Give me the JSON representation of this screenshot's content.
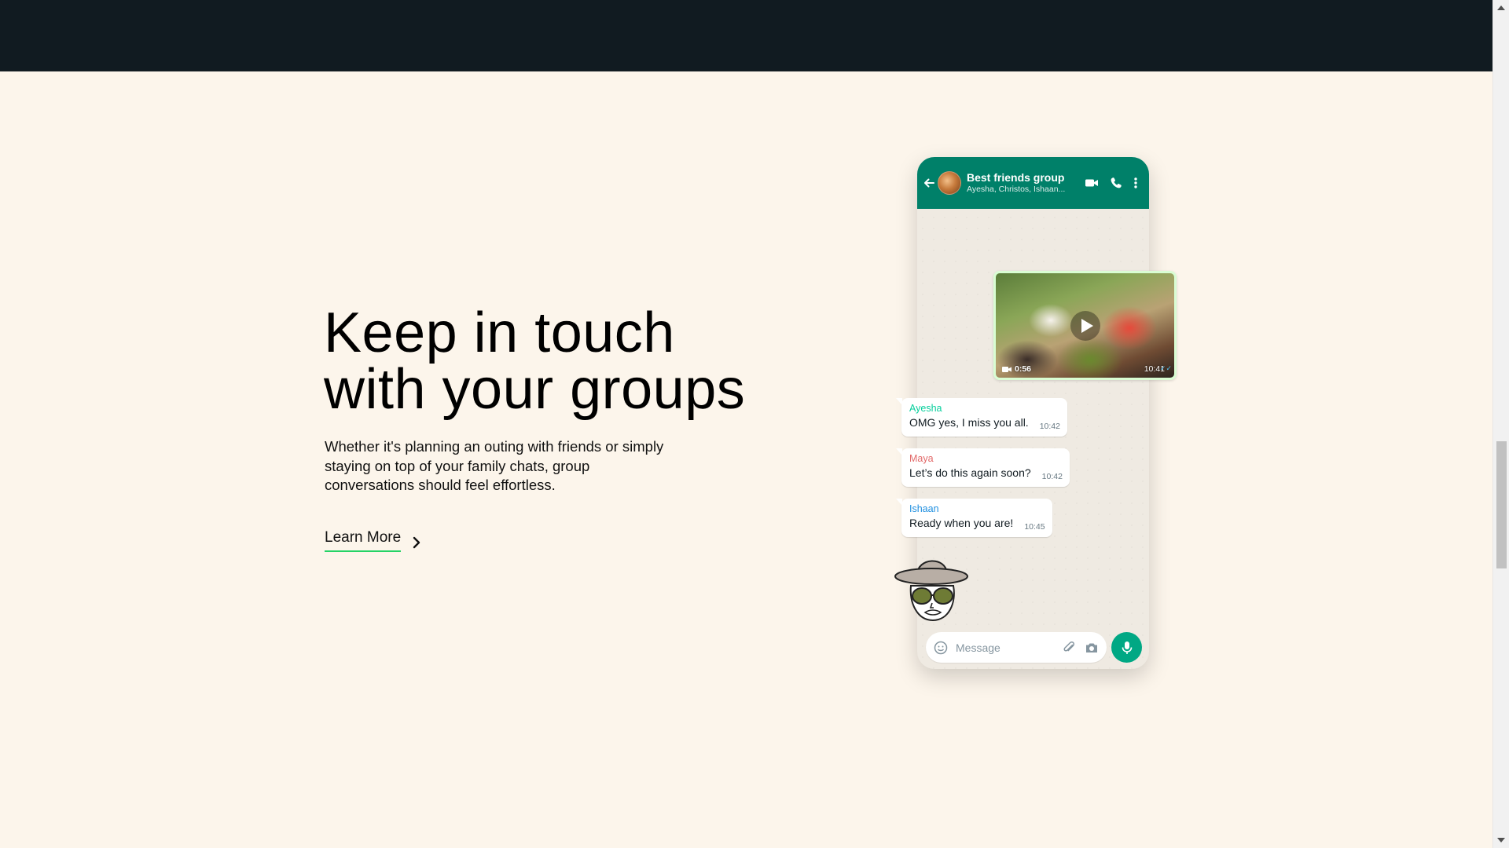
{
  "hero": {
    "title_line1": "Keep in touch",
    "title_line2": "with your groups",
    "body": "Whether it's planning an outing with friends or simply staying on top of your family chats, group conversations should feel effortless.",
    "cta_label": "Learn More"
  },
  "phone": {
    "chat_title": "Best friends group",
    "chat_subtitle": "Ayesha, Christos, Ishaan...",
    "header_color": "#008069",
    "video": {
      "duration": "0:56",
      "time": "10:41"
    },
    "messages": [
      {
        "sender": "Ayesha",
        "sender_color": "#06cf9c",
        "text": "OMG yes, I miss you all.",
        "time": "10:42"
      },
      {
        "sender": "Maya",
        "sender_color": "#e26a6a",
        "text": "Let’s do this again soon?",
        "time": "10:42"
      },
      {
        "sender": "Ishaan",
        "sender_color": "#1f8fe0",
        "text": "Ready when you are!",
        "time": "10:45"
      }
    ],
    "composer_placeholder": "Message"
  },
  "colors": {
    "page_bg": "#fcf5eb",
    "topbar": "#111b21",
    "accent": "#25d366",
    "mic": "#00a884"
  }
}
